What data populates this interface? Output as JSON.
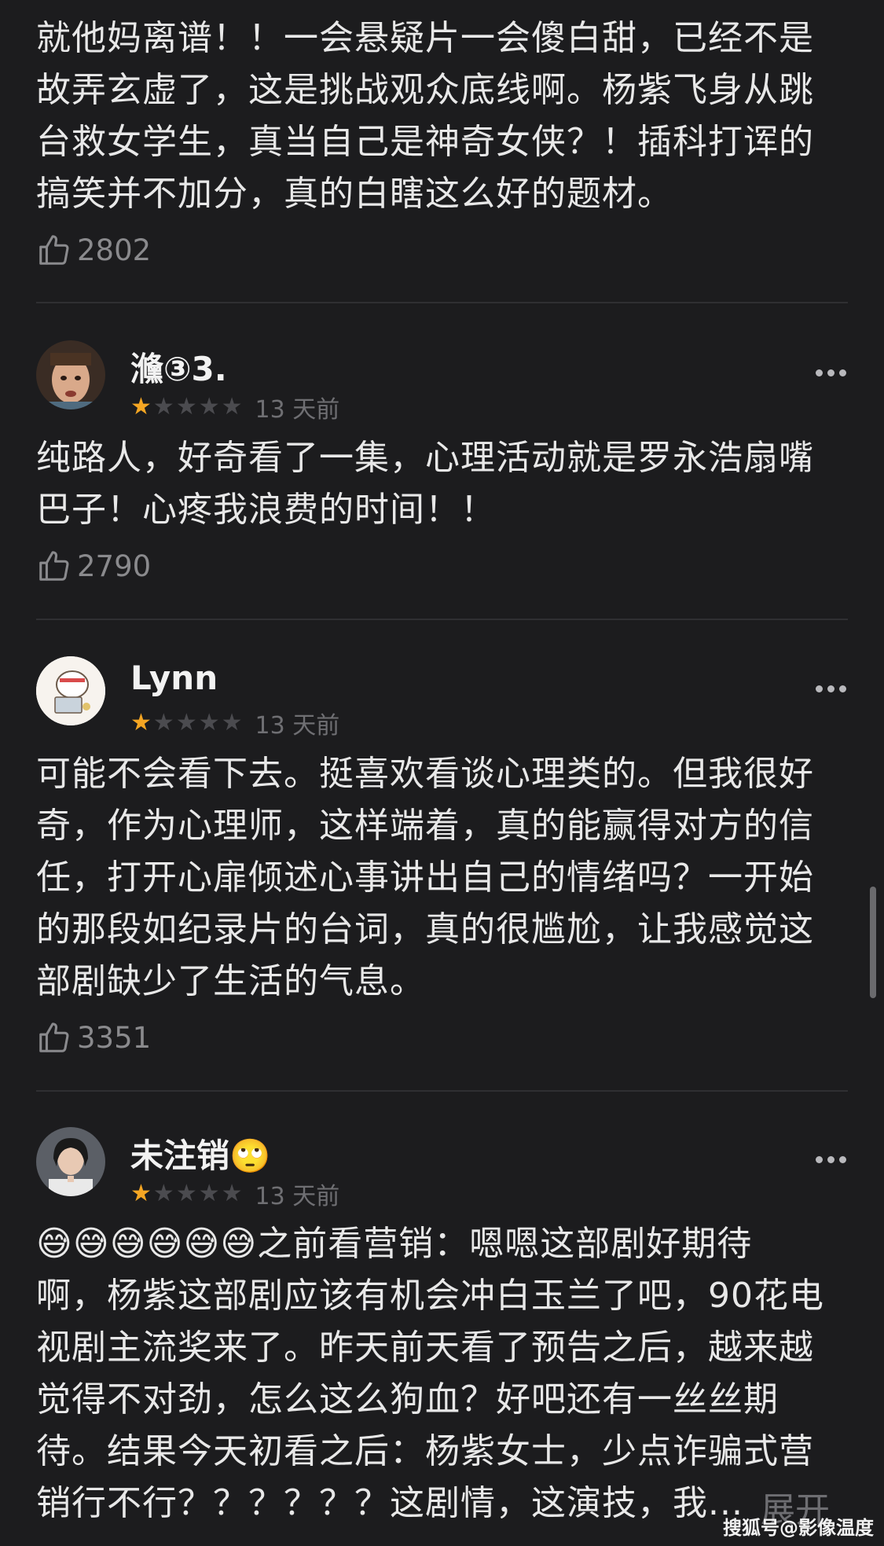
{
  "comments": [
    {
      "text": "就他妈离谱！！一会悬疑片一会傻白甜，已经不是\n故弄玄虚了，这是挑战观众底线啊。杨紫飞身从跳\n台救女学生，真当自己是神奇女侠？！插科打诨的\n搞笑并不加分，真的白瞎这么好的题材。",
      "likes": "2802"
    },
    {
      "username": "㶖③3.",
      "stars": 1,
      "time": "13 天前",
      "text": "纯路人，好奇看了一集，心理活动就是罗永浩扇嘴\n巴子！心疼我浪费的时间！！",
      "likes": "2790"
    },
    {
      "username": "Lynn",
      "stars": 1,
      "time": "13 天前",
      "text": "可能不会看下去。挺喜欢看谈心理类的。但我很好\n奇，作为心理师，这样端着，真的能赢得对方的信\n任，打开心扉倾述心事讲出自己的情绪吗？一开始\n的那段如纪录片的台词，真的很尴尬，让我感觉这\n部剧缺少了生活的气息。",
      "likes": "3351"
    },
    {
      "username": "未注销🙄",
      "stars": 1,
      "time": "13 天前",
      "text": "😅😅😅😅😅😅之前看营销：嗯嗯这部剧好期待\n啊，杨紫这部剧应该有机会冲白玉兰了吧，90花电\n视剧主流奖来了。昨天前天看了预告之后，越来越\n觉得不对劲，怎么这么狗血？好吧还有一丝丝期\n待。结果今天初看之后：杨紫女士，少点诈骗式营\n销行不行？？？？？？这剧情，这演技，我..."
    }
  ],
  "expand_label": "展开",
  "watermark": "搜狐号@影像温度",
  "colors": {
    "background": "#1c1c1e",
    "star_on": "#f5a623",
    "star_off": "#4b4b4f"
  },
  "icons": {
    "like": "thumbs-up-icon",
    "more": "more-dots-icon"
  }
}
